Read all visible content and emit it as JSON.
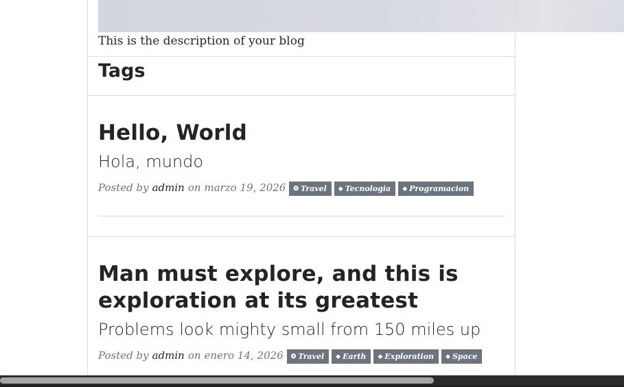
{
  "blog": {
    "description": "This is the description of your blog"
  },
  "tags_section": {
    "heading": "Tags"
  },
  "posts": [
    {
      "title": "Hello, World",
      "subtitle": "Hola, mundo",
      "posted_by": "Posted by",
      "author": "admin",
      "date_prefix": "on",
      "date": "marzo 19, 2026",
      "tags": [
        {
          "label": "Travel",
          "icon": "globe-icon",
          "glyph": "❂"
        },
        {
          "label": "Tecnologia",
          "icon": "tag-icon",
          "glyph": "◆"
        },
        {
          "label": "Programacion",
          "icon": "tag-icon",
          "glyph": "◆"
        }
      ]
    },
    {
      "title": "Man must explore, and this is exploration at its greatest",
      "subtitle": "Problems look mighty small from 150 miles up",
      "posted_by": "Posted by",
      "author": "admin",
      "date_prefix": "on",
      "date": "enero 14, 2026",
      "tags": [
        {
          "label": "Travel",
          "icon": "globe-icon",
          "glyph": "❂"
        },
        {
          "label": "Earth",
          "icon": "tag-icon",
          "glyph": "◆"
        },
        {
          "label": "Exploration",
          "icon": "tag-icon",
          "glyph": "◆"
        },
        {
          "label": "Space",
          "icon": "tag-icon",
          "glyph": "◆"
        }
      ]
    }
  ],
  "colors": {
    "text": "#212529",
    "muted": "#6c757d",
    "tag_bg": "#6c757d",
    "border": "#dedede",
    "scrollbar_track": "#2b2b2b",
    "scrollbar_thumb": "#a6a6a6"
  }
}
